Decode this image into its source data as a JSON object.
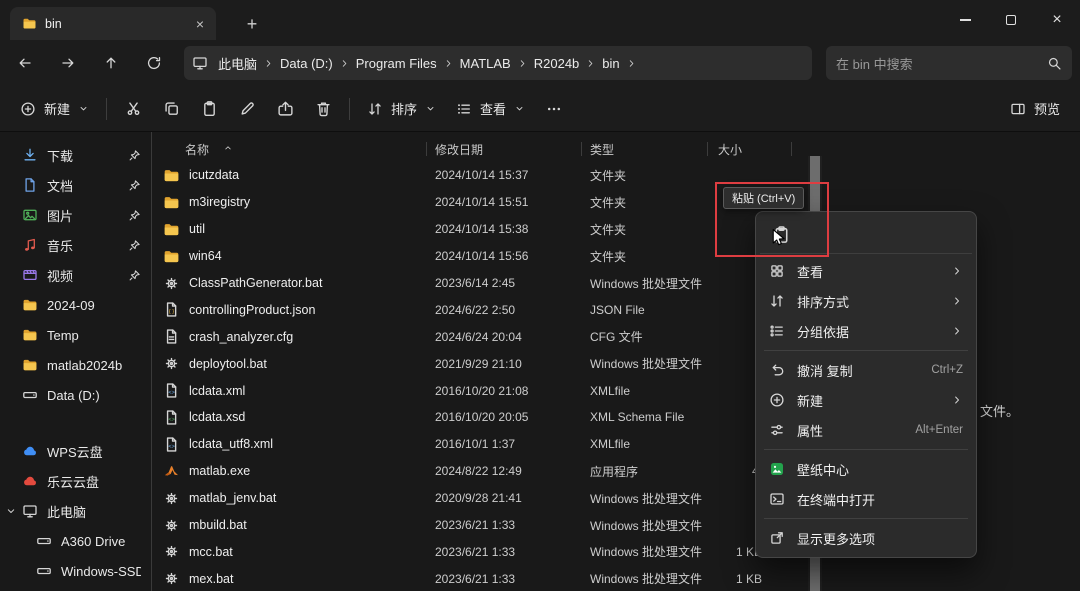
{
  "window": {
    "tab_title": "bin",
    "new_tab_glyph": "+",
    "close_glyph": "×"
  },
  "nav_buttons": [
    {
      "name": "back-button",
      "icon": "back"
    },
    {
      "name": "forward-button",
      "icon": "forward"
    },
    {
      "name": "up-button",
      "icon": "up"
    },
    {
      "name": "refresh-button",
      "icon": "refresh"
    }
  ],
  "address_bar": {
    "breadcrumbs": [
      "此电脑",
      "Data (D:)",
      "Program Files",
      "MATLAB",
      "R2024b",
      "bin"
    ],
    "search_placeholder": "在 bin 中搜索"
  },
  "toolbar": {
    "new_label": "新建",
    "icon_buttons": [
      {
        "name": "cut-button",
        "icon": "cut"
      },
      {
        "name": "copy-button",
        "icon": "copy"
      },
      {
        "name": "paste-button",
        "icon": "paste"
      },
      {
        "name": "rename-button",
        "icon": "rename"
      },
      {
        "name": "share-button",
        "icon": "share"
      },
      {
        "name": "delete-button",
        "icon": "trash"
      }
    ],
    "sort_label": "排序",
    "view_label": "查看",
    "preview_label": "预览"
  },
  "sidebar": {
    "items": [
      {
        "label": "下载",
        "icon": "downloads",
        "pinned": true
      },
      {
        "label": "文档",
        "icon": "documents",
        "pinned": true
      },
      {
        "label": "图片",
        "icon": "pictures",
        "pinned": true
      },
      {
        "label": "音乐",
        "icon": "music",
        "pinned": true
      },
      {
        "label": "视频",
        "icon": "videos",
        "pinned": true
      },
      {
        "label": "2024-09",
        "icon": "folder"
      },
      {
        "label": "Temp",
        "icon": "folder"
      },
      {
        "label": "matlab2024b",
        "icon": "folder"
      },
      {
        "label": "Data (D:)",
        "icon": "drive"
      },
      {
        "label": "WPS云盘",
        "icon": "wpscloud",
        "gap": true
      },
      {
        "label": "乐云云盘",
        "icon": "redcloud"
      },
      {
        "label": "此电脑",
        "icon": "monitor",
        "expanded": true
      },
      {
        "label": "A360 Drive",
        "icon": "drive",
        "indent": true
      },
      {
        "label": "Windows-SSD",
        "icon": "drive",
        "indent": true
      }
    ]
  },
  "file_list": {
    "columns": [
      {
        "label": "名称",
        "sorted": "asc"
      },
      {
        "label": "修改日期"
      },
      {
        "label": "类型"
      },
      {
        "label": "大小"
      }
    ],
    "rows": [
      {
        "name": "icutzdata",
        "date": "2024/10/14 15:37",
        "type": "文件夹",
        "size": "",
        "icon": "folder"
      },
      {
        "name": "m3iregistry",
        "date": "2024/10/14 15:51",
        "type": "文件夹",
        "size": "",
        "icon": "folder"
      },
      {
        "name": "util",
        "date": "2024/10/14 15:38",
        "type": "文件夹",
        "size": "",
        "icon": "folder"
      },
      {
        "name": "win64",
        "date": "2024/10/14 15:56",
        "type": "文件夹",
        "size": "",
        "icon": "folder"
      },
      {
        "name": "ClassPathGenerator.bat",
        "date": "2023/6/14 2:45",
        "type": "Windows 批处理文件",
        "size": "",
        "icon": "gear"
      },
      {
        "name": "controllingProduct.json",
        "date": "2024/6/22 2:50",
        "type": "JSON File",
        "size": "",
        "icon": "json"
      },
      {
        "name": "crash_analyzer.cfg",
        "date": "2024/6/24 20:04",
        "type": "CFG 文件",
        "size": "",
        "icon": "cfg"
      },
      {
        "name": "deploytool.bat",
        "date": "2021/9/29 21:10",
        "type": "Windows 批处理文件",
        "size": "",
        "icon": "gear"
      },
      {
        "name": "lcdata.xml",
        "date": "2016/10/20 21:08",
        "type": "XMLfile",
        "size": "",
        "icon": "xml"
      },
      {
        "name": "lcdata.xsd",
        "date": "2016/10/20 20:05",
        "type": "XML Schema File",
        "size": "",
        "icon": "xsd"
      },
      {
        "name": "lcdata_utf8.xml",
        "date": "2016/10/1 1:37",
        "type": "XMLfile",
        "size": "",
        "icon": "xml"
      },
      {
        "name": "matlab.exe",
        "date": "2024/8/22 12:49",
        "type": "应用程序",
        "size": "4,",
        "icon": "matlab"
      },
      {
        "name": "matlab_jenv.bat",
        "date": "2020/9/28 21:41",
        "type": "Windows 批处理文件",
        "size": "",
        "icon": "gear"
      },
      {
        "name": "mbuild.bat",
        "date": "2023/6/21 1:33",
        "type": "Windows 批处理文件",
        "size": "",
        "icon": "gear"
      },
      {
        "name": "mcc.bat",
        "date": "2023/6/21 1:33",
        "type": "Windows 批处理文件",
        "size": "1 KB",
        "icon": "gear"
      },
      {
        "name": "mex.bat",
        "date": "2023/6/21 1:33",
        "type": "Windows 批处理文件",
        "size": "1 KB",
        "icon": "gear"
      }
    ]
  },
  "preview_pane": {
    "visible_text": "文件。"
  },
  "context_menu": {
    "quick_actions": [
      {
        "name": "paste-button",
        "icon": "paste",
        "label": "粘贴"
      }
    ],
    "items": [
      {
        "label": "查看",
        "icon": "grid",
        "submenu": true
      },
      {
        "label": "排序方式",
        "icon": "sort",
        "submenu": true
      },
      {
        "label": "分组依据",
        "icon": "group",
        "submenu": true
      },
      {
        "divider": true
      },
      {
        "label": "撤消 复制",
        "icon": "undo",
        "shortcut": "Ctrl+Z"
      },
      {
        "label": "新建",
        "icon": "circleplus",
        "submenu": true
      },
      {
        "label": "属性",
        "icon": "properties",
        "shortcut": "Alt+Enter"
      },
      {
        "divider": true
      },
      {
        "label": "壁纸中心",
        "icon": "wallpaper"
      },
      {
        "label": "在终端中打开",
        "icon": "terminal"
      },
      {
        "divider": true
      },
      {
        "label": "显示更多选项",
        "icon": "moreoptions"
      }
    ]
  },
  "annotation": {
    "tooltip": "粘贴 (Ctrl+V)",
    "box_color": "#de3d41"
  },
  "colors": {
    "accent": "#4cc2ff",
    "folder_yellow": "#f5c64f",
    "annotation_red": "#de3d41",
    "menu_bg": "#2b2b2b"
  }
}
